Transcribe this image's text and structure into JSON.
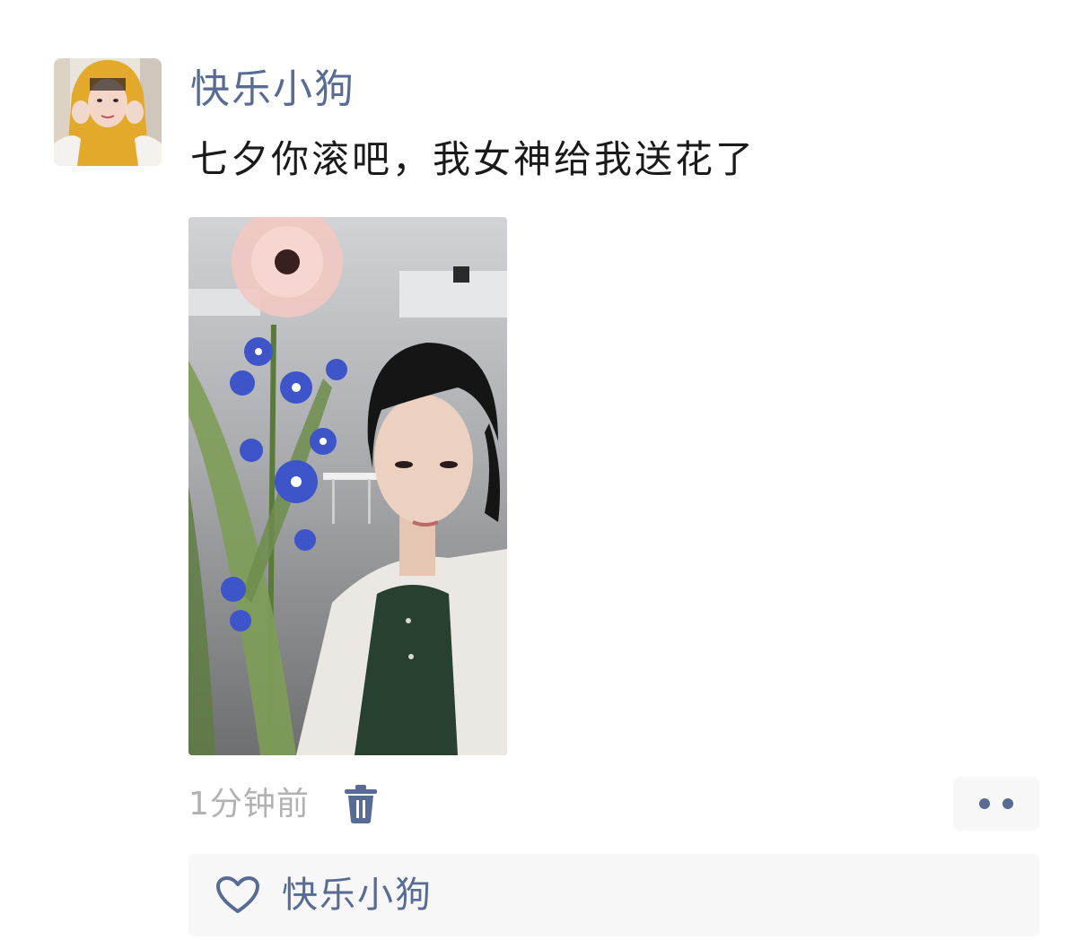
{
  "post": {
    "author": "快乐小狗",
    "text": "七夕你滚吧，我女神给我送花了",
    "timestamp": "1分钟前"
  },
  "likes": {
    "names": "快乐小狗"
  },
  "icons": {
    "avatar": "avatar",
    "delete": "trash-icon",
    "more": "more-dots-icon",
    "like": "heart-outline-icon"
  },
  "colors": {
    "name_link": "#576b95",
    "timestamp": "#b2b2b2",
    "panel_bg": "#f7f7f7"
  }
}
